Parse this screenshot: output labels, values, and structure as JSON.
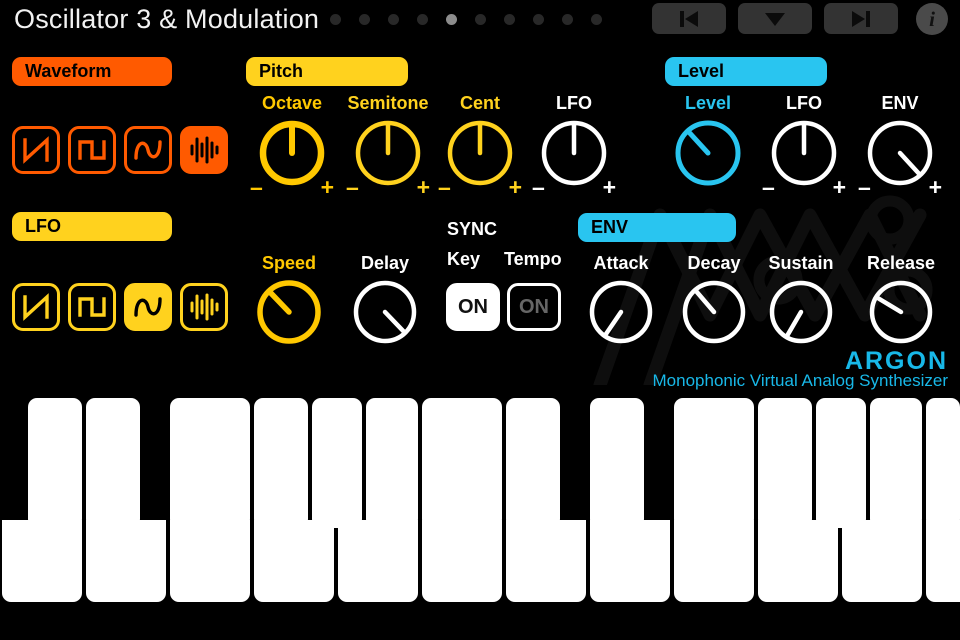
{
  "header": {
    "title": "Oscillator 3 & Modulation",
    "page_dots": {
      "count": 10,
      "active_index": 4
    },
    "buttons": [
      {
        "name": "prev-page-button",
        "icon": "skip-previous-icon"
      },
      {
        "name": "preset-list-button",
        "icon": "chevron-down-icon"
      },
      {
        "name": "next-page-button",
        "icon": "skip-next-icon"
      }
    ],
    "info_button": {
      "label": "i",
      "icon": "info-icon"
    }
  },
  "colors": {
    "orange": "#FF5A00",
    "yellow": "#FFD21E",
    "gold": "#FFC800",
    "cyan": "#29C5F0",
    "white": "#FFFFFF",
    "grey": "#666666",
    "black": "#000000"
  },
  "sections": {
    "waveform": {
      "title": "Waveform",
      "color": "#FF5A00",
      "buttons": [
        {
          "name": "waveform-saw",
          "icon": "sawtooth-wave-icon",
          "selected": false
        },
        {
          "name": "waveform-square",
          "icon": "square-wave-icon",
          "selected": false
        },
        {
          "name": "waveform-sine",
          "icon": "sine-wave-icon",
          "selected": false
        },
        {
          "name": "waveform-noise",
          "icon": "noise-wave-icon",
          "selected": true
        }
      ]
    },
    "lfo_wave": {
      "title": "LFO",
      "color": "#FFD21E",
      "buttons": [
        {
          "name": "lfo-waveform-saw",
          "icon": "sawtooth-wave-icon",
          "selected": false
        },
        {
          "name": "lfo-waveform-square",
          "icon": "square-wave-icon",
          "selected": false
        },
        {
          "name": "lfo-waveform-sine",
          "icon": "sine-wave-icon",
          "selected": true
        },
        {
          "name": "lfo-waveform-noise",
          "icon": "noise-wave-icon",
          "selected": false
        }
      ]
    },
    "pitch": {
      "title": "Pitch",
      "color": "#FFD21E",
      "knobs": [
        {
          "name": "octave",
          "label": "Octave",
          "color": "#FFC800",
          "angle": 0,
          "plus_minus": true
        },
        {
          "name": "semitone",
          "label": "Semitone",
          "color": "#FFD21E",
          "angle": 0,
          "plus_minus": true
        },
        {
          "name": "cent",
          "label": "Cent",
          "color": "#FFD21E",
          "angle": 0,
          "plus_minus": true
        },
        {
          "name": "pitch-lfo",
          "label": "LFO",
          "color": "#FFFFFF",
          "angle": 0,
          "plus_minus": true
        }
      ]
    },
    "level": {
      "title": "Level",
      "color": "#29C5F0",
      "knobs": [
        {
          "name": "level",
          "label": "Level",
          "color": "#29C5F0",
          "angle": -42,
          "plus_minus": false
        },
        {
          "name": "level-lfo",
          "label": "LFO",
          "color": "#FFFFFF",
          "angle": 0,
          "plus_minus": true
        },
        {
          "name": "level-env",
          "label": "ENV",
          "color": "#FFFFFF",
          "angle": 138,
          "plus_minus": true
        }
      ]
    },
    "lfo_params": {
      "knobs": [
        {
          "name": "lfo-speed",
          "label": "Speed",
          "color": "#FFC800",
          "angle": 42,
          "plus_minus": false
        },
        {
          "name": "lfo-delay",
          "label": "Delay",
          "color": "#FFFFFF",
          "angle": 128,
          "plus_minus": false
        }
      ],
      "sync": {
        "header": "SYNC",
        "key": {
          "label": "Key",
          "value": "ON",
          "state": "on"
        },
        "tempo": {
          "label": "Tempo",
          "value": "ON",
          "state": "off"
        }
      }
    },
    "envelope": {
      "title": "ENV",
      "color": "#29C5F0",
      "knobs": [
        {
          "name": "env-attack",
          "label": "Attack",
          "color": "#FFFFFF",
          "angle": 215,
          "plus_minus": false
        },
        {
          "name": "env-decay",
          "label": "Decay",
          "color": "#FFFFFF",
          "angle": 318,
          "plus_minus": false
        },
        {
          "name": "env-sustain",
          "label": "Sustain",
          "color": "#FFFFFF",
          "angle": 212,
          "plus_minus": false
        },
        {
          "name": "env-release",
          "label": "Release",
          "color": "#FFFFFF",
          "angle": 300,
          "plus_minus": false
        }
      ]
    }
  },
  "brand": {
    "name": "ARGON",
    "tagline": "Monophonic Virtual Analog Synthesizer",
    "color": "#18B8E8"
  },
  "keyboard": {
    "white_key_count": 13,
    "black_key_pattern": [
      1,
      1,
      0,
      1,
      1,
      1,
      0
    ],
    "octaves_visible": 2
  }
}
